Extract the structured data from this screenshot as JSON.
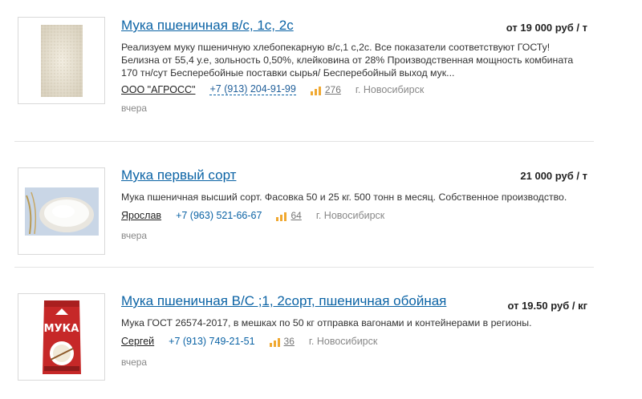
{
  "listings": [
    {
      "title": "Мука пшеничная в/с, 1с, 2с",
      "price": "от 19 000 руб / т",
      "description": "Реализуем муку пшеничную хлебопекарную в/с,1 с,2с. Все показатели соответствуют ГОСТу! Белизна от 55,4 у.е, зольность 0,50%, клейковина от 28% Производственная мощность комбината 170 тн/сут Бесперебойные поставки сырья/ Бесперебойный выход мук...",
      "seller": "ООО \"АГРОСС\"",
      "phone": "+7 (913) 204-91-99",
      "views": "276",
      "city": "г. Новосибирск",
      "date": "вчера",
      "image": "flour-closeup-photo"
    },
    {
      "title": "Мука первый сорт",
      "price": "21 000 руб / т",
      "description": "Мука пшеничная высший сорт. Фасовка 50 и 25 кг. 500 тонн в месяц. Собственное производство.",
      "seller": "Ярослав",
      "phone": "+7 (963) 521-66-67",
      "views": "64",
      "city": "г. Новосибирск",
      "date": "вчера",
      "image": "flour-bowl-photo"
    },
    {
      "title": "Мука пшеничная В/С ;1, 2сорт, пшеничная обойная",
      "price": "от 19.50 руб / кг",
      "description": "Мука ГОСТ 26574-2017, в мешках по 50 кг отправка вагонами и контейнерами в регионы.",
      "seller": "Сергей",
      "phone": "+7 (913) 749-21-51",
      "views": "36",
      "city": "г. Новосибирск",
      "date": "вчера",
      "image": "flour-bag-photo",
      "package_text": "МУКА"
    }
  ],
  "colors": {
    "link": "#0b63a5",
    "stats_icon": "#f0a830",
    "bag_red": "#c62828"
  }
}
